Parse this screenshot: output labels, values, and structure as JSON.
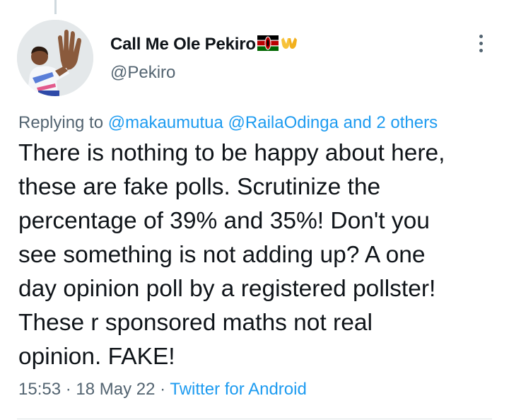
{
  "tweet": {
    "author": {
      "display_name": "Call Me Ole Pekiro",
      "flag_icon": "kenya-flag-icon",
      "hands_icon": "raising-hands-icon",
      "handle": "@Pekiro"
    },
    "replying_prefix": "Replying to",
    "replying_to": [
      "@makaumutua",
      "@RailaOdinga"
    ],
    "replying_and_others": "and 2 others",
    "text_lines": [
      "There is nothing to be happy about here,",
      "these are fake polls. Scrutinize the",
      "percentage of 39% and 35%! Don't you",
      "see something is not adding up? A one",
      "day opinion poll by a registered pollster!",
      "These r sponsored maths not real",
      "opinion. FAKE!"
    ],
    "time": "15:53",
    "date": "18 May 22",
    "source": "Twitter for Android",
    "separator": "·"
  },
  "colors": {
    "text": "#0f1419",
    "secondary": "#536471",
    "link": "#1d9bf0",
    "divider": "#dfe4e6"
  }
}
